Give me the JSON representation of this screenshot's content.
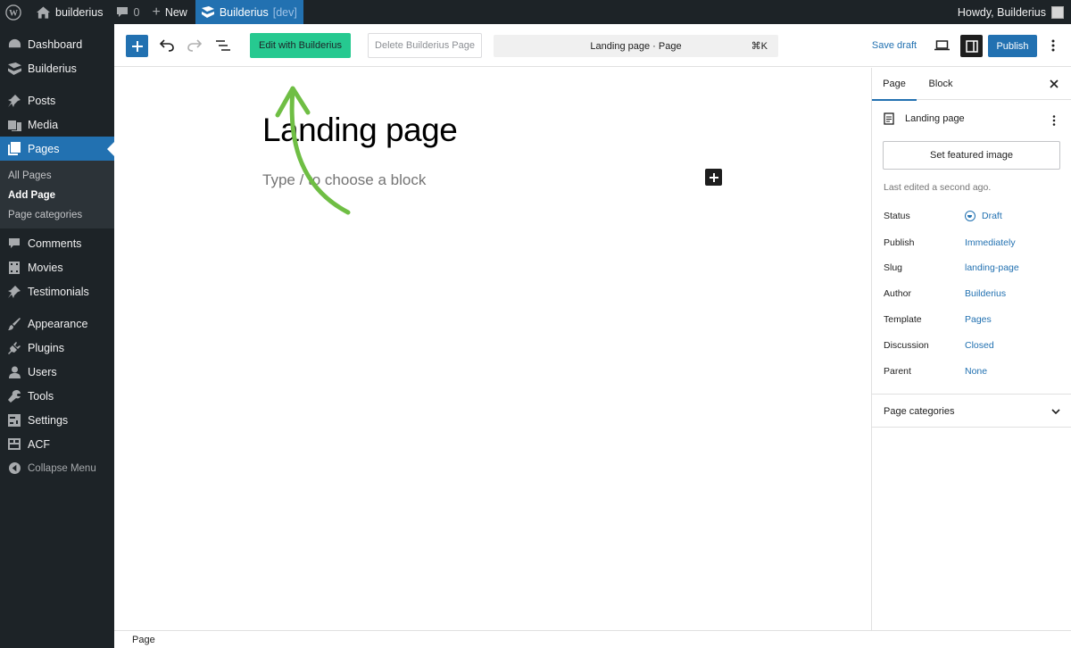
{
  "admin_bar": {
    "site_name": "builderius",
    "comments_count": "0",
    "new_label": "New",
    "builderius_label": "Builderius",
    "builderius_env": "[dev]",
    "howdy": "Howdy, Builderius"
  },
  "sidebar": {
    "items": [
      {
        "label": "Dashboard",
        "icon": "dashboard-icon"
      },
      {
        "label": "Builderius",
        "icon": "builderius-icon"
      },
      {
        "label": "Posts",
        "icon": "pin-icon"
      },
      {
        "label": "Media",
        "icon": "media-icon"
      },
      {
        "label": "Pages",
        "icon": "pages-icon"
      },
      {
        "label": "Comments",
        "icon": "comment-icon"
      },
      {
        "label": "Movies",
        "icon": "movies-icon"
      },
      {
        "label": "Testimonials",
        "icon": "pin-icon"
      },
      {
        "label": "Appearance",
        "icon": "brush-icon"
      },
      {
        "label": "Plugins",
        "icon": "plugin-icon"
      },
      {
        "label": "Users",
        "icon": "users-icon"
      },
      {
        "label": "Tools",
        "icon": "wrench-icon"
      },
      {
        "label": "Settings",
        "icon": "settings-icon"
      },
      {
        "label": "ACF",
        "icon": "acf-icon"
      },
      {
        "label": "Collapse Menu",
        "icon": "collapse-icon"
      }
    ],
    "submenu": [
      "All Pages",
      "Add Page",
      "Page categories"
    ]
  },
  "toolbar": {
    "edit_builderius": "Edit with Builderius",
    "delete_builderius": "Delete Builderius Page",
    "document_title": "Landing page · Page",
    "shortcut": "⌘K",
    "save_draft": "Save draft",
    "publish": "Publish"
  },
  "editor": {
    "title": "Landing page",
    "placeholder": "Type / to choose a block"
  },
  "panel": {
    "tabs": [
      "Page",
      "Block"
    ],
    "doc_title": "Landing page",
    "featured_image": "Set featured image",
    "last_edited": "Last edited a second ago.",
    "rows": [
      {
        "label": "Status",
        "value": "Draft"
      },
      {
        "label": "Publish",
        "value": "Immediately"
      },
      {
        "label": "Slug",
        "value": "landing-page"
      },
      {
        "label": "Author",
        "value": "Builderius"
      },
      {
        "label": "Template",
        "value": "Pages"
      },
      {
        "label": "Discussion",
        "value": "Closed"
      },
      {
        "label": "Parent",
        "value": "None"
      }
    ],
    "section": "Page categories"
  },
  "statusbar": {
    "breadcrumb": "Page"
  },
  "colors": {
    "accent": "#2271b1",
    "builderius_green": "#26c990",
    "arrow_green": "#6fbe44",
    "admin_dark": "#1d2327"
  }
}
